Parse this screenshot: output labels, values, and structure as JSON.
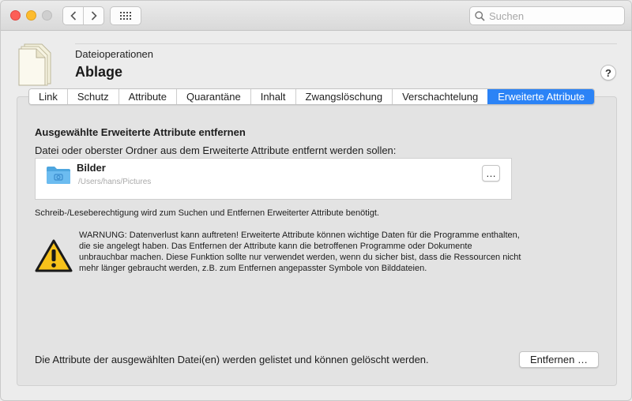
{
  "toolbar": {
    "search_placeholder": "Suchen"
  },
  "header": {
    "subtitle": "Dateioperationen",
    "title": "Ablage",
    "help_label": "?"
  },
  "tabs": [
    {
      "label": "Link",
      "active": false
    },
    {
      "label": "Schutz",
      "active": false
    },
    {
      "label": "Attribute",
      "active": false
    },
    {
      "label": "Quarantäne",
      "active": false
    },
    {
      "label": "Inhalt",
      "active": false
    },
    {
      "label": "Zwangslöschung",
      "active": false
    },
    {
      "label": "Verschachtelung",
      "active": false
    },
    {
      "label": "Erweiterte Attribute",
      "active": true
    }
  ],
  "main": {
    "section_title": "Ausgewählte Erweiterte Attribute entfernen",
    "section_desc": "Datei oder oberster Ordner aus dem Erweiterte Attribute entfernt werden sollen:",
    "file": {
      "name": "Bilder",
      "path": "/Users/hans/Pictures",
      "more_label": "…"
    },
    "permission_note": "Schreib-/Leseberechtigung wird zum Suchen und Entfernen Erweiterter Attribute benötigt.",
    "warning_text": "WARNUNG: Datenverlust kann auftreten! Erweiterte Attribute können wichtige Daten für die Programme enthalten, die sie angelegt haben. Das Entfernen der Attribute kann die betroffenen Programme oder Dokumente unbrauchbar machen. Diese Funktion sollte nur verwendet werden, wenn du sicher bist, dass die Ressourcen nicht mehr länger gebraucht werden, z.B. zum Entfernen angepasster Symbole von Bilddateien.",
    "footer_text": "Die Attribute der ausgewählten Datei(en) werden gelistet und können gelöscht werden.",
    "remove_label": "Entfernen …"
  },
  "icons": {
    "window_close": "close-dot",
    "window_minimize": "minimize-dot",
    "window_zoom": "zoom-dot",
    "back": "chevron-left-icon",
    "forward": "chevron-right-icon",
    "grid": "grid-icon",
    "search": "search-icon",
    "document": "document-icon",
    "folder": "pictures-folder-icon",
    "warning": "warning-icon"
  },
  "colors": {
    "accent": "#2b83f6",
    "close": "#fc5f57",
    "minimize": "#fdbc2e",
    "folder": "#5ab0e8",
    "warning": "#f7c21a"
  }
}
